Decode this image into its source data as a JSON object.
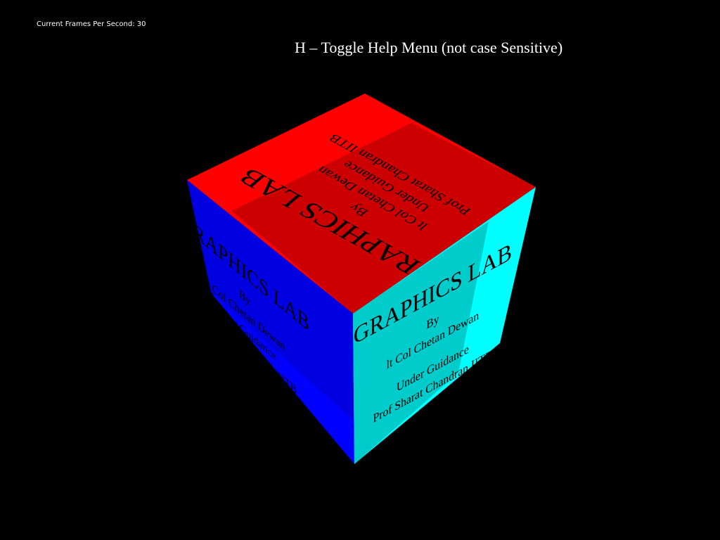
{
  "hud": {
    "fps_label": "Current Frames Per Second:",
    "fps_value": "30",
    "help_text": "H – Toggle Help Menu (not case Sensitive)"
  },
  "cube": {
    "faces": {
      "top": {
        "color": "#ff0000",
        "shade": "#cc0000"
      },
      "left": {
        "color": "#0000ff",
        "shade": "#0000e0"
      },
      "right": {
        "color": "#00ffff",
        "shade": "#00cccc"
      }
    },
    "label": {
      "title": "GRAPHICS LAB",
      "by": "By",
      "author": "lt Col Chetan Dewan",
      "guidance": "Under Guidance",
      "professor": "Prof Sharat Chandran  IITB"
    }
  }
}
